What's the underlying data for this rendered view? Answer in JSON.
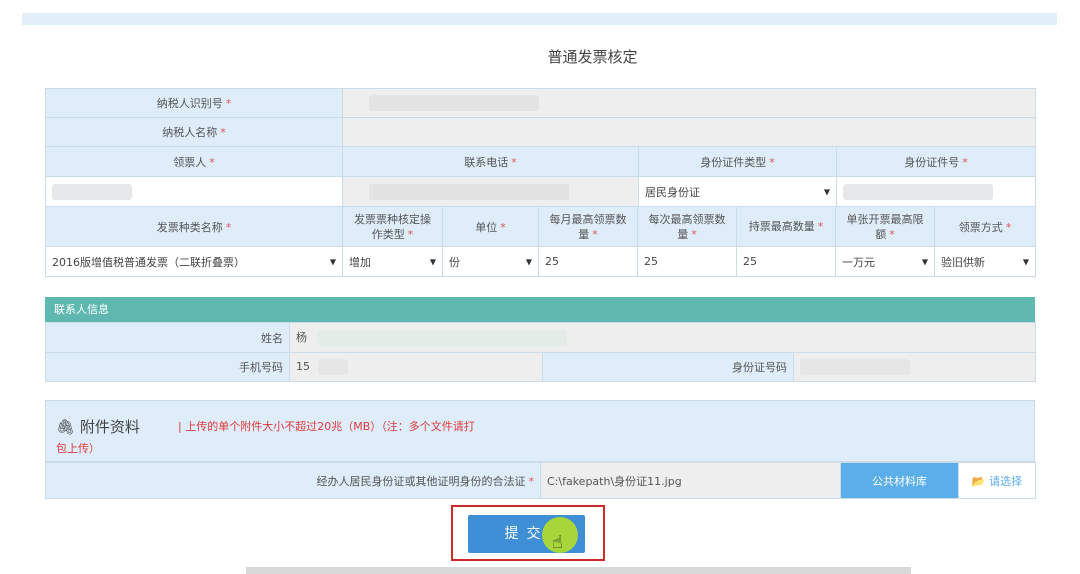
{
  "title": "普通发票核定",
  "form": {
    "taxpayer_id_label": "纳税人识别号",
    "taxpayer_name_label": "纳税人名称",
    "recipient_label": "领票人",
    "phone_label": "联系电话",
    "id_type_label": "身份证件类型",
    "id_number_label": "身份证件号",
    "id_type_value": "居民身份证",
    "required_mark": "*"
  },
  "invoice": {
    "headers": {
      "type_name": "发票种类名称",
      "op_type": "发票票种核定操作类型",
      "unit": "单位",
      "monthly_max": "每月最高领票数量",
      "per_max": "每次最高领票数量",
      "hold_max": "持票最高数量",
      "single_limit": "单张开票最高限额",
      "method": "领票方式"
    },
    "row": {
      "type_name": "2016版增值税普通发票（二联折叠票）",
      "op_type": "增加",
      "unit": "份",
      "monthly_max": "25",
      "per_max": "25",
      "hold_max": "25",
      "single_limit": "一万元",
      "method": "验旧供新"
    }
  },
  "contact": {
    "section_title": "联系人信息",
    "name_label": "姓名",
    "name_value": "杨",
    "mobile_label": "手机号码",
    "mobile_value": "15",
    "id_no_label": "身份证号码"
  },
  "attachments": {
    "title": "附件资料",
    "note_line1": "| 上传的单个附件大小不超过20兆（MB）（注：多个文件请打",
    "note_line2": "包上传）",
    "doc_label": "经办人居民身份证或其他证明身份的合法证",
    "file_path": "C:\\fakepath\\身份证11.jpg",
    "library_button": "公共材料库",
    "choose_button": "请选择"
  },
  "submit_label": "提交"
}
